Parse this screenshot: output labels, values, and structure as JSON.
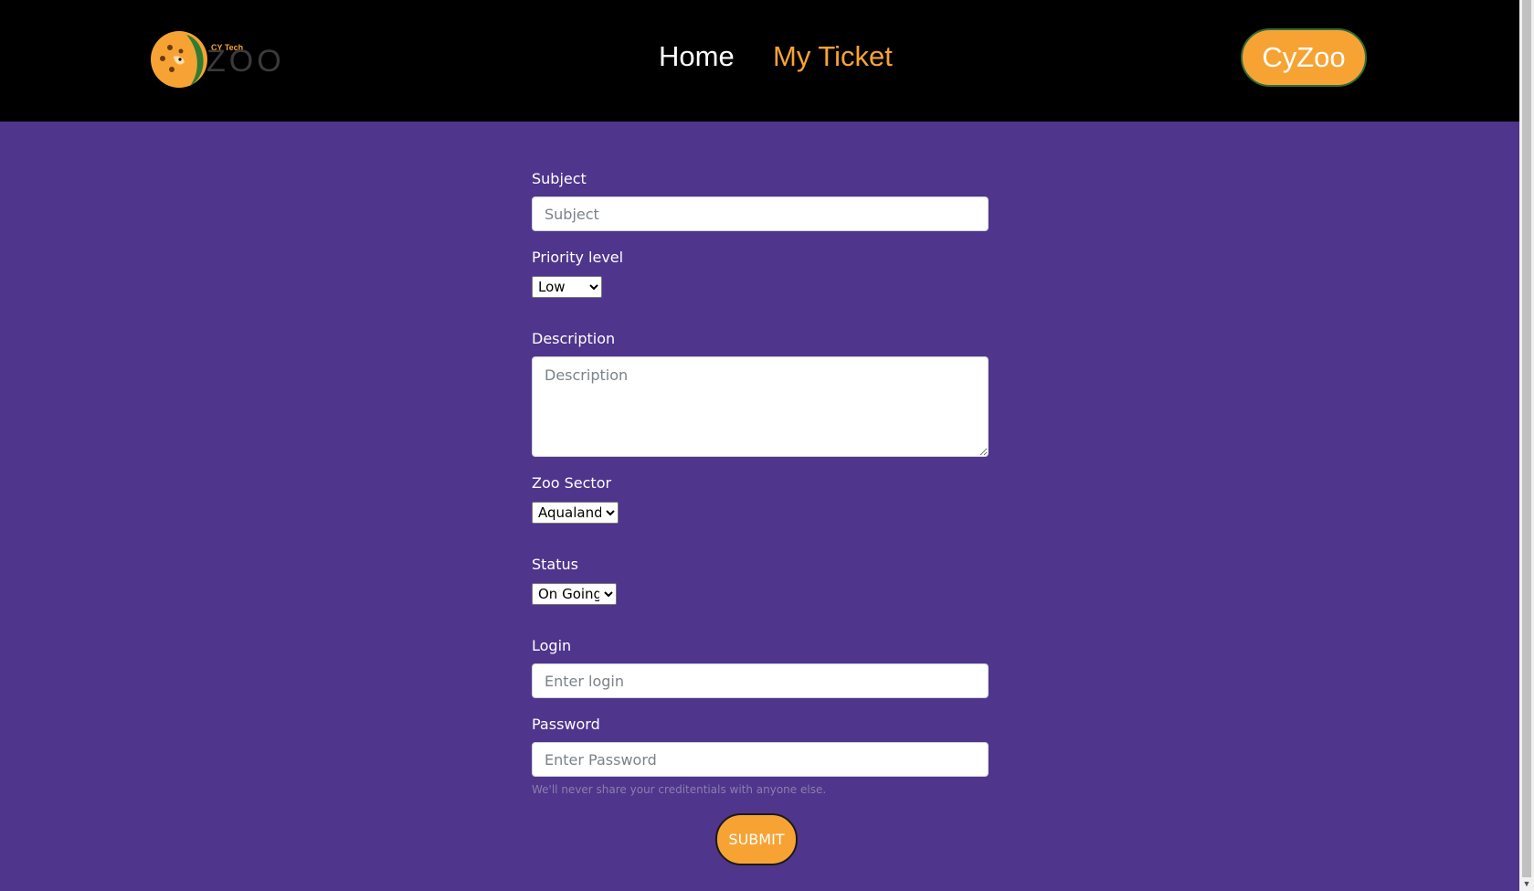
{
  "header": {
    "logo": {
      "small_text": "CY Tech",
      "big_text": "ZOO"
    },
    "nav": {
      "home": "Home",
      "my_ticket": "My Ticket"
    },
    "brand_button": "CyZoo"
  },
  "form": {
    "subject": {
      "label": "Subject",
      "placeholder": "Subject",
      "value": ""
    },
    "priority": {
      "label": "Priority level",
      "selected": "Low"
    },
    "description": {
      "label": "Description",
      "placeholder": "Description",
      "value": ""
    },
    "sector": {
      "label": "Zoo Sector",
      "selected": "Aqualand"
    },
    "status": {
      "label": "Status",
      "selected": "On Going"
    },
    "login": {
      "label": "Login",
      "placeholder": "Enter login",
      "value": ""
    },
    "password": {
      "label": "Password",
      "placeholder": "Enter Password",
      "value": ""
    },
    "help_text": "We'll never share your creditentials with anyone else.",
    "submit_label": "SUBMIT"
  },
  "colors": {
    "background": "#4f358c",
    "header": "#000000",
    "accent": "#f7a334",
    "text": "#ffffff"
  }
}
